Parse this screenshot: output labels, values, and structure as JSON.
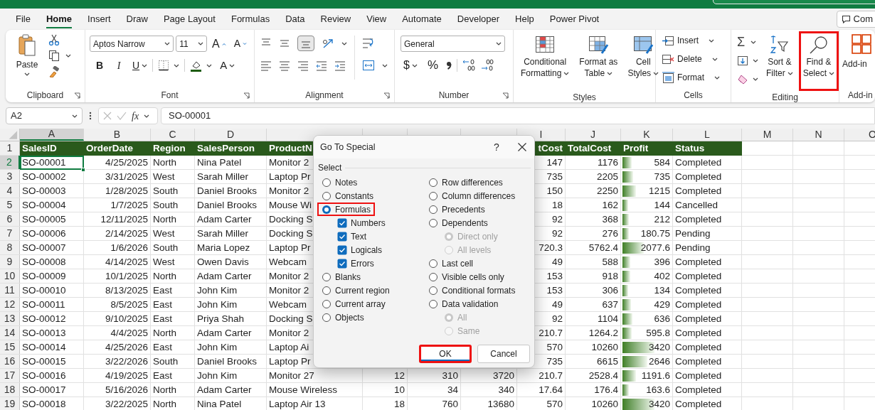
{
  "tabs": [
    {
      "label": "File",
      "selected": false
    },
    {
      "label": "Home",
      "selected": true
    },
    {
      "label": "Insert",
      "selected": false
    },
    {
      "label": "Draw",
      "selected": false
    },
    {
      "label": "Page Layout",
      "selected": false
    },
    {
      "label": "Formulas",
      "selected": false
    },
    {
      "label": "Data",
      "selected": false
    },
    {
      "label": "Review",
      "selected": false
    },
    {
      "label": "View",
      "selected": false
    },
    {
      "label": "Automate",
      "selected": false
    },
    {
      "label": "Developer",
      "selected": false
    },
    {
      "label": "Help",
      "selected": false
    },
    {
      "label": "Power Pivot",
      "selected": false
    }
  ],
  "comments_button": {
    "label": "Com"
  },
  "ribbon": {
    "groups": [
      {
        "kind": "clipboard",
        "label": "Clipboard",
        "launcher": true,
        "paste": "Paste"
      },
      {
        "kind": "font",
        "label": "Font",
        "launcher": true,
        "font_name": "Aptos Narrow",
        "font_size": "11",
        "grow": "A",
        "shrink": "A",
        "bold": "B",
        "italic": "I",
        "underline": "U",
        "font_color": "A"
      },
      {
        "kind": "alignment",
        "label": "Alignment",
        "launcher": true
      },
      {
        "kind": "number",
        "label": "Number",
        "launcher": true,
        "format": "General",
        "currency": "$",
        "percent": "%"
      },
      {
        "kind": "styles",
        "label": "Styles",
        "launcher": false,
        "buttons": [
          {
            "kind": "conditional",
            "lines": [
              "Conditional",
              "Formatting"
            ]
          },
          {
            "kind": "table",
            "lines": [
              "Format as",
              "Table"
            ]
          },
          {
            "kind": "cell",
            "lines": [
              "Cell",
              "Styles"
            ]
          }
        ]
      },
      {
        "kind": "cells",
        "label": "Cells",
        "launcher": false,
        "buttons": [
          {
            "kind": "insert",
            "label": "Insert"
          },
          {
            "kind": "delete",
            "label": "Delete"
          },
          {
            "kind": "format",
            "label": "Format"
          }
        ]
      },
      {
        "kind": "editing",
        "label": "Editing",
        "launcher": false,
        "autosum": "Σ",
        "buttons": [
          {
            "kind": "sort",
            "lines": [
              "Sort &",
              "Filter"
            ],
            "highlighted": false
          },
          {
            "kind": "find",
            "lines": [
              "Find &",
              "Select"
            ],
            "highlighted": true
          }
        ]
      },
      {
        "kind": "addins",
        "label": "Add-in",
        "launcher": false,
        "button": "Add-in"
      }
    ]
  },
  "formula_bar": {
    "name_box": "A2",
    "function_label": "fx",
    "formula": "SO-00001"
  },
  "sheet": {
    "columns": [
      {
        "letter": "A",
        "selected": true
      },
      {
        "letter": "B",
        "selected": false
      },
      {
        "letter": "C",
        "selected": false
      },
      {
        "letter": "D",
        "selected": false
      },
      {
        "selected": false
      },
      {
        "selected": false
      },
      {
        "selected": false
      },
      {
        "selected": false
      },
      {
        "letter": "I",
        "selected": false
      },
      {
        "letter": "J",
        "selected": false
      },
      {
        "letter": "K",
        "selected": false
      },
      {
        "letter": "L",
        "selected": false
      },
      {
        "letter": "M",
        "selected": false
      },
      {
        "letter": "N",
        "selected": false
      },
      {
        "letter": "O",
        "selected": false
      }
    ],
    "rows": [
      {
        "number": "1",
        "kind": "header",
        "selected": false,
        "cells": {
          "A": "SalesID",
          "B": "OrderDate",
          "C": "Region",
          "D": "SalesPerson",
          "E": "ProductN",
          "I": "tCost",
          "J": "TotalCost",
          "K": "Profit",
          "L": "Status"
        }
      },
      {
        "number": "2",
        "kind": "data",
        "selected": true,
        "cells": {
          "A": "SO-00001",
          "B": "4/25/2025",
          "C": "North",
          "D": "Nina Patel",
          "E": "Monitor 2",
          "I": "147",
          "J": "1176",
          "K": "584",
          "L": "Completed"
        },
        "data_bar": {
          "level": 0.18
        }
      },
      {
        "number": "3",
        "kind": "data",
        "selected": false,
        "cells": {
          "A": "SO-00002",
          "B": "3/31/2025",
          "C": "West",
          "D": "Sarah Miller",
          "E": "Laptop Pr",
          "I": "735",
          "J": "2205",
          "K": "735",
          "L": "Completed"
        },
        "data_bar": {
          "level": 0.21
        }
      },
      {
        "number": "4",
        "kind": "data",
        "selected": false,
        "cells": {
          "A": "SO-00003",
          "B": "1/28/2025",
          "C": "South",
          "D": "Daniel Brooks",
          "E": "Monitor 2",
          "I": "150",
          "J": "2250",
          "K": "1215",
          "L": "Completed"
        },
        "data_bar": {
          "level": 0.27
        }
      },
      {
        "number": "5",
        "kind": "data",
        "selected": false,
        "cells": {
          "A": "SO-00004",
          "B": "1/7/2025",
          "C": "South",
          "D": "Daniel Brooks",
          "E": "Mouse Wi",
          "I": "18",
          "J": "162",
          "K": "144",
          "L": "Cancelled"
        },
        "data_bar": {
          "level": 0.11
        }
      },
      {
        "number": "6",
        "kind": "data",
        "selected": false,
        "cells": {
          "A": "SO-00005",
          "B": "12/11/2025",
          "C": "North",
          "D": "Adam Carter",
          "E": "Docking S",
          "I": "92",
          "J": "368",
          "K": "212",
          "L": "Completed"
        },
        "data_bar": {
          "level": 0.12
        }
      },
      {
        "number": "7",
        "kind": "data",
        "selected": false,
        "cells": {
          "A": "SO-00006",
          "B": "2/14/2025",
          "C": "West",
          "D": "Sarah Miller",
          "E": "Docking S",
          "I": "92",
          "J": "276",
          "K": "180.75",
          "L": "Pending"
        },
        "data_bar": {
          "level": 0.12
        }
      },
      {
        "number": "8",
        "kind": "data",
        "selected": false,
        "cells": {
          "A": "SO-00007",
          "B": "1/6/2026",
          "C": "South",
          "D": "Maria Lopez",
          "E": "Laptop Pr",
          "I": "720.3",
          "J": "5762.4",
          "K": "2077.6",
          "L": "Pending"
        },
        "data_bar": {
          "level": 0.41
        }
      },
      {
        "number": "9",
        "kind": "data",
        "selected": false,
        "cells": {
          "A": "SO-00008",
          "B": "4/14/2025",
          "C": "West",
          "D": "Owen Davis",
          "E": "Webcam",
          "I": "49",
          "J": "588",
          "K": "396",
          "L": "Completed"
        },
        "data_bar": {
          "level": 0.15
        }
      },
      {
        "number": "10",
        "kind": "data",
        "selected": false,
        "cells": {
          "A": "SO-00009",
          "B": "10/1/2025",
          "C": "North",
          "D": "Adam Carter",
          "E": "Monitor 2",
          "I": "153",
          "J": "918",
          "K": "402",
          "L": "Completed"
        },
        "data_bar": {
          "level": 0.15
        }
      },
      {
        "number": "11",
        "kind": "data",
        "selected": false,
        "cells": {
          "A": "SO-00010",
          "B": "8/13/2025",
          "C": "East",
          "D": "John Kim",
          "E": "Monitor 2",
          "I": "153",
          "J": "306",
          "K": "134",
          "L": "Completed"
        },
        "data_bar": {
          "level": 0.11
        }
      },
      {
        "number": "12",
        "kind": "data",
        "selected": false,
        "cells": {
          "A": "SO-00011",
          "B": "8/5/2025",
          "C": "East",
          "D": "John Kim",
          "E": "Webcam",
          "I": "49",
          "J": "637",
          "K": "429",
          "L": "Completed"
        },
        "data_bar": {
          "level": 0.16
        }
      },
      {
        "number": "13",
        "kind": "data",
        "selected": false,
        "cells": {
          "A": "SO-00012",
          "B": "9/10/2025",
          "C": "East",
          "D": "Priya Shah",
          "E": "Docking S",
          "I": "92",
          "J": "1104",
          "K": "636",
          "L": "Completed"
        },
        "data_bar": {
          "level": 0.19
        }
      },
      {
        "number": "14",
        "kind": "data",
        "selected": false,
        "cells": {
          "A": "SO-00013",
          "B": "4/4/2025",
          "C": "North",
          "D": "Adam Carter",
          "E": "Monitor 2",
          "I": "210.7",
          "J": "1264.2",
          "K": "595.8",
          "L": "Completed"
        },
        "data_bar": {
          "level": 0.18
        }
      },
      {
        "number": "15",
        "kind": "data",
        "selected": false,
        "cells": {
          "A": "SO-00014",
          "B": "4/25/2026",
          "C": "East",
          "D": "John Kim",
          "E": "Laptop Ai",
          "I": "570",
          "J": "10260",
          "K": "3420",
          "L": "Completed"
        },
        "data_bar": {
          "level": 0.62
        }
      },
      {
        "number": "16",
        "kind": "data",
        "selected": false,
        "cells": {
          "A": "SO-00015",
          "B": "3/22/2026",
          "C": "South",
          "D": "Daniel Brooks",
          "E": "Laptop Pr",
          "I": "735",
          "J": "6615",
          "K": "2646",
          "L": "Completed"
        },
        "data_bar": {
          "level": 0.49
        }
      },
      {
        "number": "17",
        "kind": "data",
        "selected": false,
        "cells": {
          "A": "SO-00016",
          "B": "4/19/2025",
          "C": "East",
          "D": "John Kim",
          "E": "Monitor 27",
          "F": "12",
          "G": "310",
          "H": "3720",
          "I": "210.7",
          "J": "2528.4",
          "K": "1191.6",
          "L": "Completed"
        },
        "data_bar": {
          "level": 0.27
        }
      },
      {
        "number": "18",
        "kind": "data",
        "selected": false,
        "cells": {
          "A": "SO-00017",
          "B": "5/16/2026",
          "C": "North",
          "D": "Adam Carter",
          "E": "Mouse Wireless",
          "F": "10",
          "G": "34",
          "H": "340",
          "I": "17.64",
          "J": "176.4",
          "K": "163.6",
          "L": "Completed"
        },
        "data_bar": {
          "level": 0.12
        }
      },
      {
        "number": "19",
        "kind": "data",
        "selected": false,
        "cells": {
          "A": "SO-00018",
          "B": "3/22/2025",
          "C": "North",
          "D": "Nina Patel",
          "E": "Laptop Air 13",
          "F": "18",
          "G": "760",
          "H": "13680",
          "I": "570",
          "J": "10260",
          "K": "3420",
          "L": "Completed"
        },
        "data_bar": {
          "level": 0.62
        }
      }
    ]
  },
  "dialog": {
    "title": "Go To Special",
    "help": "?",
    "group_label": "Select",
    "left_options": [
      {
        "label": "Notes",
        "selected": false,
        "highlighted": false
      },
      {
        "label": "Constants",
        "selected": false,
        "highlighted": false
      },
      {
        "label": "Formulas",
        "selected": true,
        "highlighted": true,
        "children": [
          {
            "label": "Numbers",
            "checked": true
          },
          {
            "label": "Text",
            "checked": true
          },
          {
            "label": "Logicals",
            "checked": true
          },
          {
            "label": "Errors",
            "checked": true
          }
        ]
      },
      {
        "label": "Blanks",
        "selected": false,
        "highlighted": false
      },
      {
        "label": "Current region",
        "selected": false,
        "highlighted": false
      },
      {
        "label": "Current array",
        "selected": false,
        "highlighted": false
      },
      {
        "label": "Objects",
        "selected": false,
        "highlighted": false
      }
    ],
    "right_options": [
      {
        "label": "Row differences",
        "selected": false,
        "highlighted": false
      },
      {
        "label": "Column differences",
        "selected": false,
        "highlighted": false
      },
      {
        "label": "Precedents",
        "selected": false,
        "highlighted": false
      },
      {
        "label": "Dependents",
        "selected": false,
        "highlighted": false,
        "children": [
          {
            "label": "Direct only",
            "selected": true,
            "disabled": true
          },
          {
            "label": "All levels",
            "selected": false,
            "disabled": true
          }
        ]
      },
      {
        "label": "Last cell",
        "selected": false,
        "highlighted": false
      },
      {
        "label": "Visible cells only",
        "selected": false,
        "highlighted": false
      },
      {
        "label": "Conditional formats",
        "selected": false,
        "highlighted": false
      },
      {
        "label": "Data validation",
        "selected": false,
        "highlighted": false,
        "children": [
          {
            "label": "All",
            "selected": true,
            "disabled": true
          },
          {
            "label": "Same",
            "selected": false,
            "disabled": true
          }
        ]
      }
    ],
    "buttons": [
      {
        "label": "OK",
        "default": true,
        "highlighted": true
      },
      {
        "label": "Cancel",
        "default": false,
        "highlighted": false
      }
    ]
  }
}
